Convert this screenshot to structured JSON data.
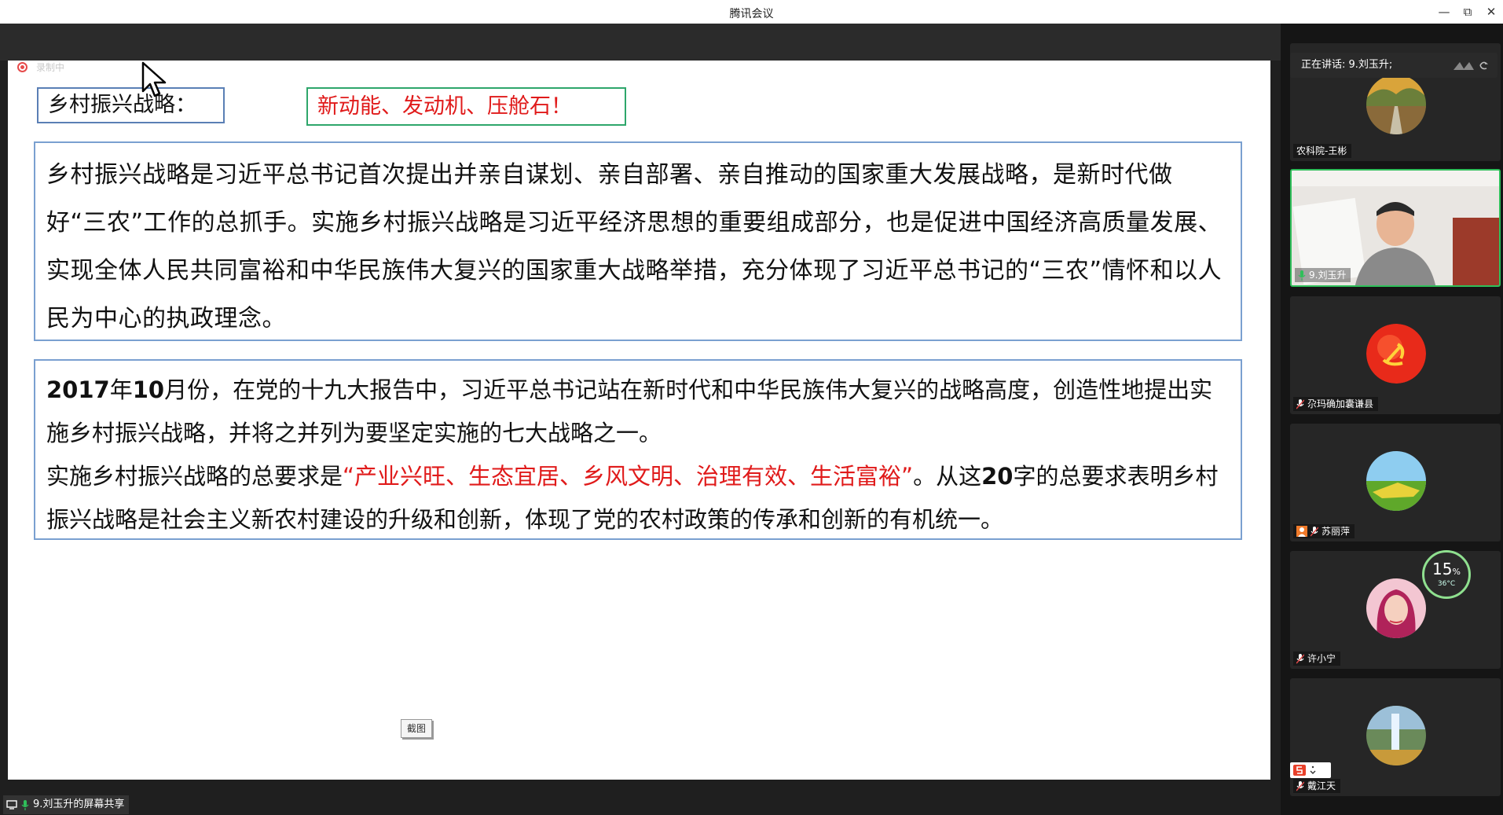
{
  "window": {
    "title": "腾讯会议",
    "minimize": "—",
    "restore": "⧉",
    "close": "✕"
  },
  "recording": {
    "label": "录制中"
  },
  "slide": {
    "heading": "乡村振兴战略：",
    "slogan": "新动能、发动机、压舱石！",
    "para1": "乡村振兴战略是习近平总书记首次提出并亲自谋划、亲自部署、亲自推动的国家重大发展战略，是新时代做好“三农”工作的总抓手。实施乡村振兴战略是习近平经济思想的重要组成部分，也是促进中国经济高质量发展、实现全体人民共同富裕和中华民族伟大复兴的国家重大战略举措，充分体现了习近平总书记的“三农”情怀和以人民为中心的执政理念。",
    "para2_year": "2017",
    "para2_y_label": "年",
    "para2_month": "10",
    "para2_rest": "月份，在党的十九大报告中，习近平总书记站在新时代和中华民族伟大复兴的战略高度，创造性地提出实施乡村振兴战略，并将之并列为要坚定实施的七大战略之一。",
    "para3_lead": "实施乡村振兴战略的总要求是",
    "para3_red": "“产业兴旺、生态宜居、乡风文明、治理有效、生活富裕”",
    "para3_mid": "。从这",
    "para3_num": "20",
    "para3_rest": "字的总要求表明乡村振兴战略是社会主义新农村建设的升级和创新，体现了党的农村政策的传承和创新的有机统一。",
    "screenshot_tag": "截图"
  },
  "share": {
    "label": "9.刘玉升的屏幕共享"
  },
  "panel": {
    "speaking": "正在讲话: 9.刘玉升;",
    "participants": [
      {
        "name": "农科院-王彬"
      },
      {
        "name": "9.刘玉升"
      },
      {
        "name": "尕玛确加囊谦县"
      },
      {
        "name": "苏丽萍"
      },
      {
        "name": "许小宁"
      },
      {
        "name": "戴江天"
      }
    ],
    "gauge": {
      "percent": "15",
      "unit": "%",
      "temp": "36°C"
    }
  },
  "colors": {
    "accent_green": "#2fbf5a",
    "slogan_red": "#e01a1a",
    "box_blue": "#5a7fb5"
  }
}
